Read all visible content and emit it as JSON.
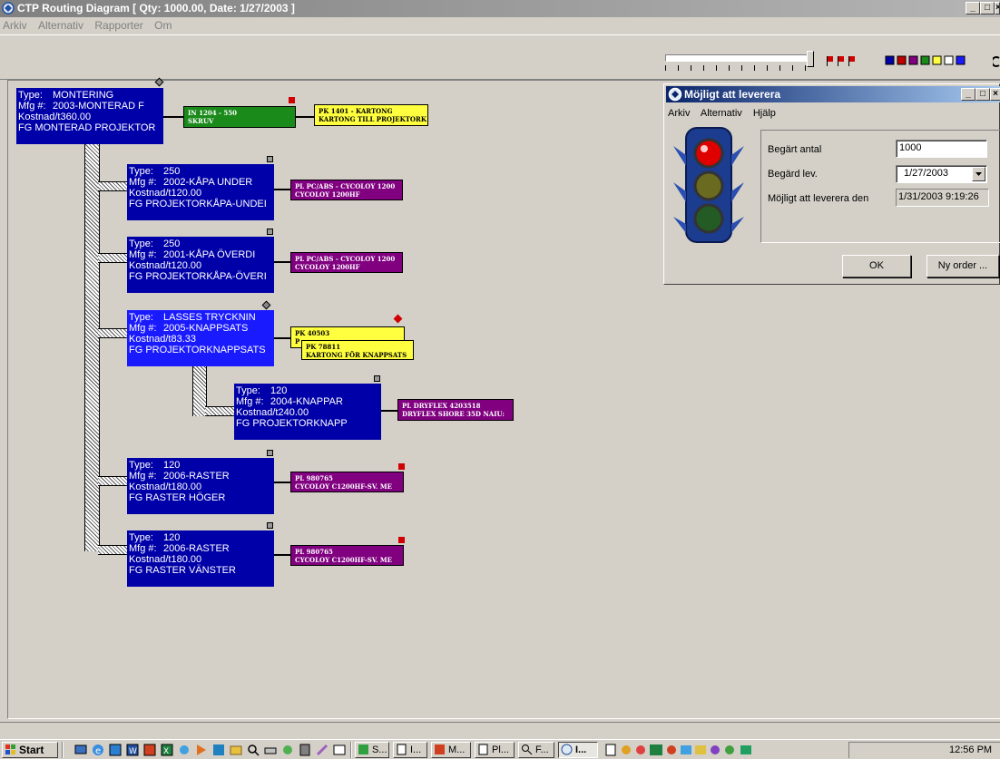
{
  "window": {
    "title": "CTP Routing Diagram  [ Qty: 1000.00, Date: 1/27/2003 ]",
    "min": "_",
    "max": "□",
    "close": "×"
  },
  "menu": [
    "Arkiv",
    "Alternativ",
    "Rapporter",
    "Om"
  ],
  "nodes": [
    {
      "type_label": "Type:",
      "type": "MONTERING",
      "mfg_label": "Mfg #:",
      "mfg": "2003-MONTERAD F",
      "cost": "Kostnad/t360.00",
      "desc": "FG MONTERAD PROJEKTOR"
    },
    {
      "type_label": "Type:",
      "type": "250",
      "mfg_label": "Mfg #:",
      "mfg": "2002-KÅPA UNDER",
      "cost": "Kostnad/t120.00",
      "desc": "FG PROJEKTORKÅPA-UNDEI"
    },
    {
      "type_label": "Type:",
      "type": "250",
      "mfg_label": "Mfg #:",
      "mfg": "2001-KÅPA ÖVERDI",
      "cost": "Kostnad/t120.00",
      "desc": "FG PROJEKTORKÅPA-ÖVERI"
    },
    {
      "type_label": "Type:",
      "type": "LASSES TRYCKNIN",
      "mfg_label": "Mfg #:",
      "mfg": "2005-KNAPPSATS",
      "cost": "Kostnad/t83.33",
      "desc": "FG PROJEKTORKNAPPSATS"
    },
    {
      "type_label": "Type:",
      "type": "120",
      "mfg_label": "Mfg #:",
      "mfg": "2004-KNAPPAR",
      "cost": "Kostnad/t240.00",
      "desc": "FG PROJEKTORKNAPP"
    },
    {
      "type_label": "Type:",
      "type": "120",
      "mfg_label": "Mfg #:",
      "mfg": "2006-RASTER",
      "cost": "Kostnad/t180.00",
      "desc": "FG RASTER HÖGER"
    },
    {
      "type_label": "Type:",
      "type": "120",
      "mfg_label": "Mfg #:",
      "mfg": "2006-RASTER",
      "cost": "Kostnad/t180.00",
      "desc": "FG RASTER VÄNSTER"
    }
  ],
  "parts": {
    "in_skruv": [
      "IN 1204 - 550",
      "SKRUV"
    ],
    "pk_1401": [
      "PK 1401 - KARTONG",
      "KARTONG TILL PROJEKTORK"
    ],
    "pl_under": [
      "PL PC/ABS - CYCOLOY 1200",
      "CYCOLOY 1200HF"
    ],
    "pl_over": [
      "PL PC/ABS - CYCOLOY 1200",
      "CYCOLOY 1200HF"
    ],
    "pk_40503": [
      "PK 40503",
      "P"
    ],
    "pk_78811": [
      "PK 78811",
      "KARTONG FÖR KNAPPSATS"
    ],
    "pl_dryflex": [
      "PL DRYFLEX 4203518",
      "DRYFLEX SHORE 35D NAIU:"
    ],
    "pl_hoger": [
      "PL 980765",
      "CYCOLOY C1200HF-SV. ME"
    ],
    "pl_vanster": [
      "PL 980765",
      "CYCOLOY C1200HF-SV. ME"
    ]
  },
  "dialog": {
    "title": "Möjligt att leverera",
    "menu": [
      "Arkiv",
      "Alternativ",
      "Hjälp"
    ],
    "qty_label": "Begärt antal",
    "qty_value": "1000",
    "date_label": "Begärd lev.",
    "date_value": "1/27/2003",
    "possible_label": "Möjligt att leverera den",
    "possible_value": "1/31/2003 9:19:26",
    "ok_label": "OK",
    "new_order_label": "Ny order ..."
  },
  "taskbar": {
    "start": "Start",
    "buttons": [
      "S...",
      "I...",
      "M...",
      "Pl...",
      "F...",
      "I..."
    ],
    "clock": "12:56 PM"
  },
  "colors": {
    "node_blue": "#0000a8",
    "node_highlight": "#1a1aff",
    "green": "#1a8a1a",
    "yellow": "#ffff40",
    "purple": "#800080"
  }
}
